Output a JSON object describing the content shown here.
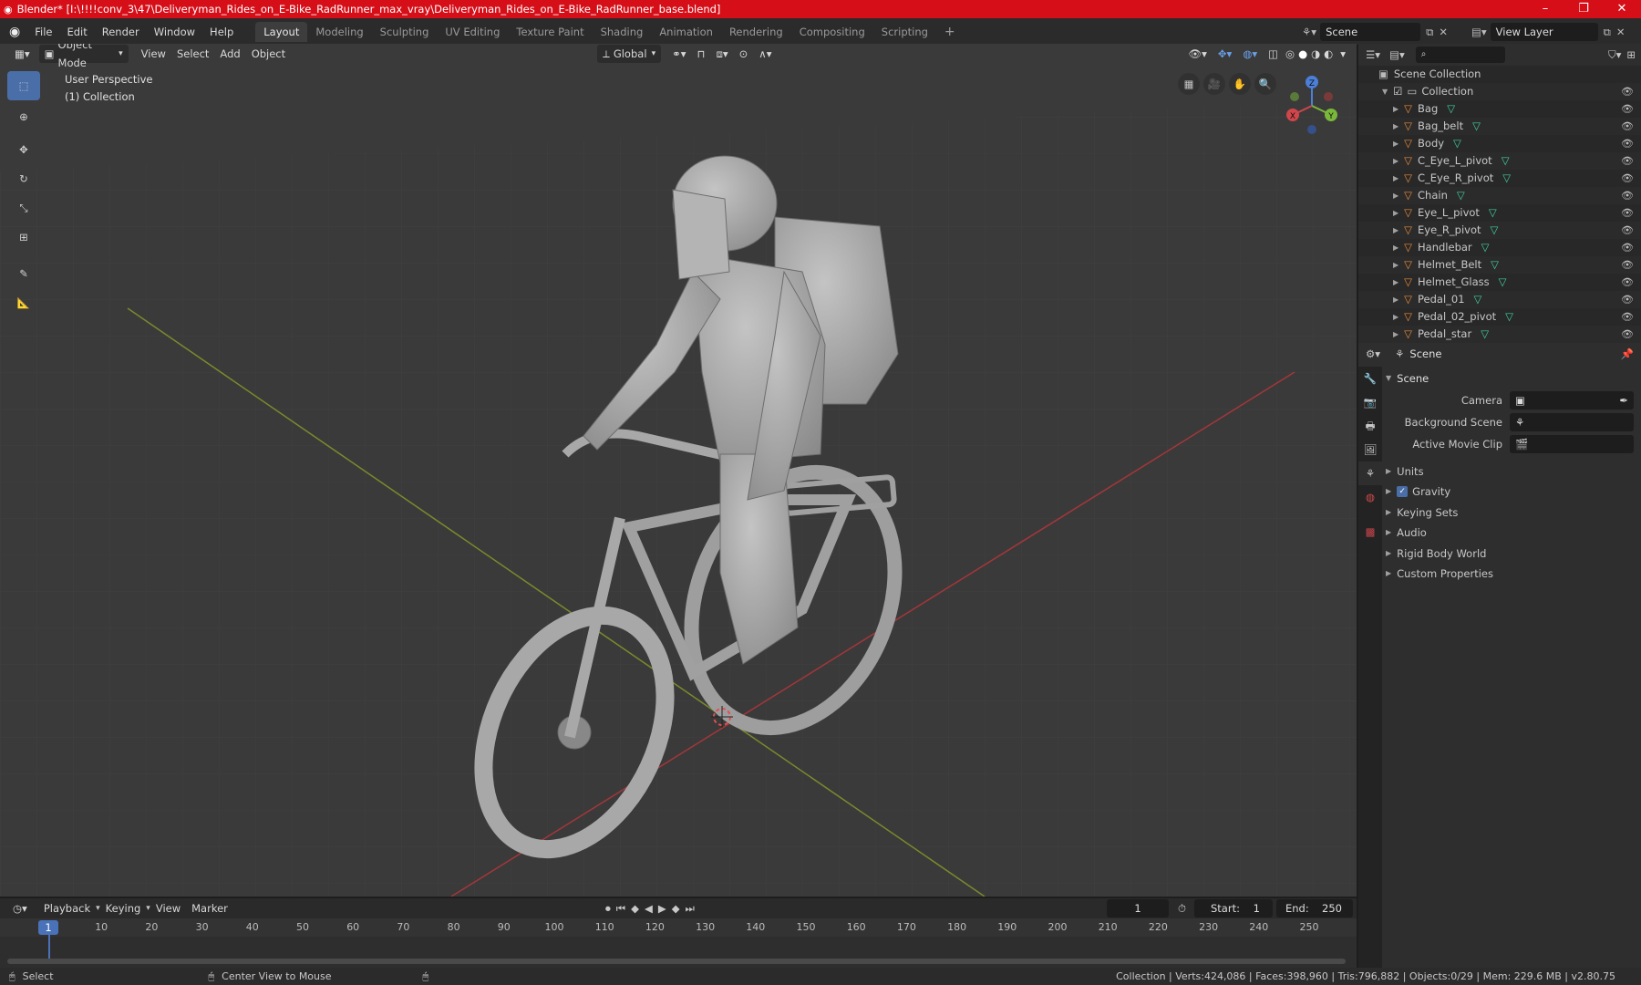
{
  "titlebar": {
    "title": "Blender* [I:\\!!!!conv_3\\47\\Deliveryman_Rides_on_E-Bike_RadRunner_max_vray\\Deliveryman_Rides_on_E-Bike_RadRunner_base.blend]",
    "minimize": "–",
    "maximize": "❐",
    "close": "✕"
  },
  "menu": {
    "items": [
      "File",
      "Edit",
      "Render",
      "Window",
      "Help"
    ],
    "workspaces": [
      "Layout",
      "Modeling",
      "Sculpting",
      "UV Editing",
      "Texture Paint",
      "Shading",
      "Animation",
      "Rendering",
      "Compositing",
      "Scripting"
    ],
    "active_workspace": "Layout",
    "add_tab": "+",
    "scene_label": "Scene",
    "view_layer_label": "View Layer"
  },
  "viewport": {
    "mode": "Object Mode",
    "menus": [
      "View",
      "Select",
      "Add",
      "Object"
    ],
    "transform_orientation": "Global",
    "overlay_line1": "User Perspective",
    "overlay_line2": "(1) Collection",
    "gizmo": {
      "z": "Z",
      "y": "Y",
      "x": "X"
    }
  },
  "outliner": {
    "search_placeholder": "",
    "root": "Scene Collection",
    "collection": "Collection",
    "objects": [
      "Bag",
      "Bag_belt",
      "Body",
      "C_Eye_L_pivot",
      "C_Eye_R_pivot",
      "Chain",
      "Eye_L_pivot",
      "Eye_R_pivot",
      "Handlebar",
      "Helmet_Belt",
      "Helmet_Glass",
      "Pedal_01",
      "Pedal_02_pivot",
      "Pedal_star"
    ]
  },
  "properties": {
    "context": "Scene",
    "section": "Scene",
    "camera_label": "Camera",
    "bg_scene_label": "Background Scene",
    "movie_clip_label": "Active Movie Clip",
    "panels": [
      "Units",
      "Gravity",
      "Keying Sets",
      "Audio",
      "Rigid Body World",
      "Custom Properties"
    ]
  },
  "timeline": {
    "menus": [
      "Playback",
      "Keying",
      "View",
      "Marker"
    ],
    "current_frame": "1",
    "start_label": "Start:",
    "start_value": "1",
    "end_label": "End:",
    "end_value": "250",
    "ruler": [
      "10",
      "20",
      "30",
      "40",
      "50",
      "60",
      "70",
      "80",
      "90",
      "100",
      "110",
      "120",
      "130",
      "140",
      "150",
      "160",
      "170",
      "180",
      "190",
      "200",
      "210",
      "220",
      "230",
      "240",
      "250"
    ],
    "playhead": "1"
  },
  "statusbar": {
    "select": "Select",
    "center": "Center View to Mouse",
    "stats": "Collection | Verts:424,086 | Faces:398,960 | Tris:796,882 | Objects:0/29 | Mem: 229.6 MB | v2.80.75"
  },
  "colors": {
    "titlebar": "#d50e18",
    "accent": "#4a6ea8",
    "object_icon": "#e88a3a",
    "mesh_icon": "#3fd0a0"
  }
}
